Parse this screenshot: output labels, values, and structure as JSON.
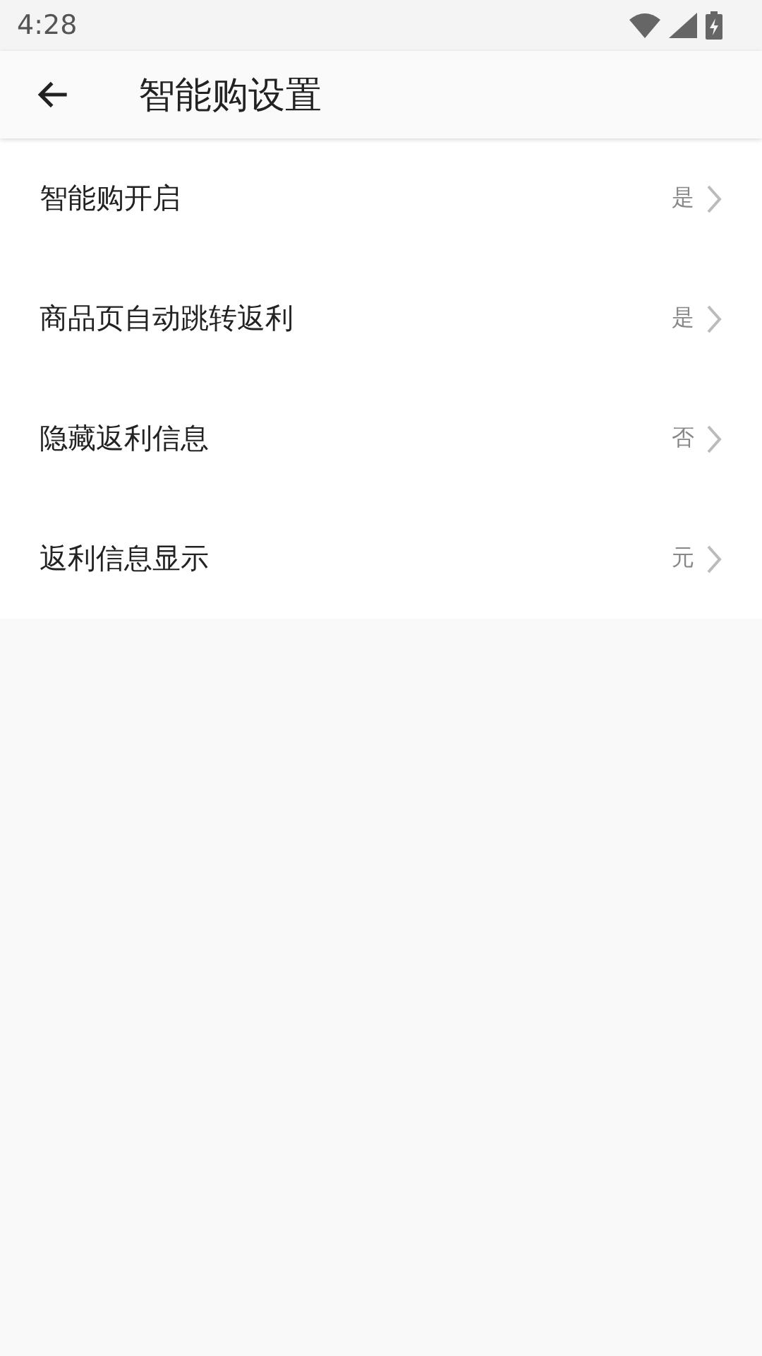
{
  "status_bar": {
    "time": "4:28"
  },
  "app_bar": {
    "title": "智能购设置"
  },
  "settings": [
    {
      "label": "智能购开启",
      "value": "是"
    },
    {
      "label": "商品页自动跳转返利",
      "value": "是"
    },
    {
      "label": "隐藏返利信息",
      "value": "否"
    },
    {
      "label": "返利信息显示",
      "value": "元"
    }
  ]
}
